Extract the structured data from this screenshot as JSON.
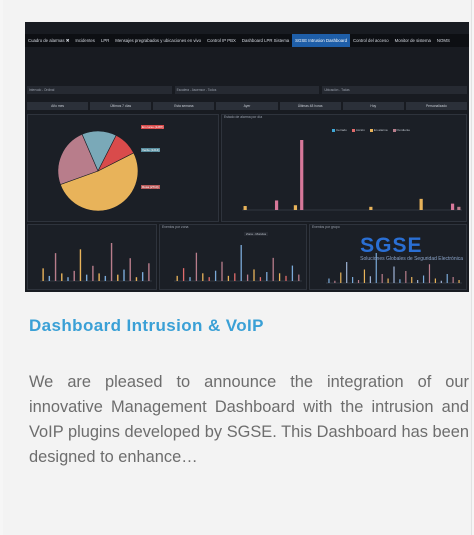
{
  "screenshot": {
    "nav_items": [
      "Cuadro de alarmas ✖",
      "Incidentes",
      "LPR",
      "Mensajes pregrabados y ubicaciones en vivo",
      "Control IP PBX",
      "Dashboard LPR Sistema",
      "SGSE Intrusion Dashboard",
      "Control del acceso",
      "Monitor de sistema",
      "NOMS"
    ],
    "active_nav": "SGSE Intrusion Dashboard",
    "filters": [
      "Intervalo - Ordinal",
      "Escalera - Ascensor - Todos",
      "Ubicación - Todas"
    ],
    "tabs": [
      "Año mes",
      "Últimos 7 días",
      "Esta semana",
      "Ayer",
      "Últimas 48 horas",
      "Hoy",
      "Personalizado"
    ],
    "panel_titles": {
      "bars_top": "Estado de alarma por día",
      "bottom_mid": "Eventos por zona",
      "bottom_right": "Eventos por grupo"
    },
    "pie_labels": [
      "En curso (1287)",
      "Verde (1214)",
      "Rosa (2714)"
    ],
    "pie_colors": [
      "#e8b35a",
      "#b87d8b",
      "#7aa9b8",
      "#d94b4b"
    ],
    "pie_values": [
      0.52,
      0.24,
      0.14,
      0.1
    ],
    "top_legend": [
      "Cerrado",
      "Acción",
      "En alarma",
      "Pendiente"
    ],
    "top_legend_colors": [
      "#3fa7d6",
      "#e06b6b",
      "#e8b35a",
      "#b87d8b"
    ],
    "top_bars": [
      5,
      0,
      0,
      0,
      0,
      12,
      0,
      0,
      6,
      88,
      0,
      0,
      0,
      0,
      0,
      0,
      0,
      0,
      0,
      0,
      4,
      0,
      0,
      0,
      0,
      0,
      0,
      0,
      14,
      0,
      0,
      0,
      0,
      8,
      4
    ],
    "bottom_left_bars": [
      10,
      4,
      22,
      6,
      3,
      8,
      25,
      5,
      12,
      6,
      4,
      30,
      5,
      9,
      18,
      3,
      7,
      14
    ],
    "bottom_mid_bars": [
      4,
      10,
      3,
      22,
      6,
      3,
      8,
      15,
      4,
      6,
      28,
      5,
      9,
      3,
      7,
      18,
      6,
      4,
      12,
      5
    ],
    "bottom_right_bars": [
      6,
      3,
      14,
      28,
      8,
      4,
      18,
      9,
      40,
      12,
      6,
      22,
      5,
      16,
      8,
      4,
      10,
      25,
      6,
      3,
      12,
      8,
      4
    ],
    "mid_zone_select": "Zona - Mundos",
    "watermark": "SGSE",
    "watermark_sub": "Soluciones Globales de Seguridad Electrónica"
  },
  "card": {
    "title": "Dashboard Intrusion & VoIP",
    "description": "We are pleased to announce the integration of our innovative Management Dashboard with the intrusion and VoIP plugins developed by SGSE. This Dashboard has been designed to enhance…"
  }
}
